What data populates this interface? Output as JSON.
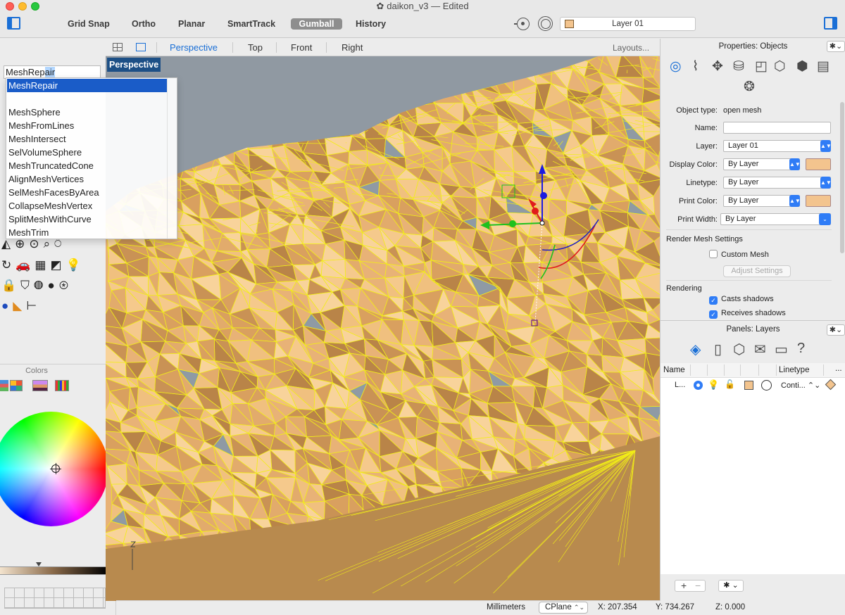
{
  "window": {
    "title": "daikon_v3 — Edited"
  },
  "toolbar": {
    "grid_snap": "Grid Snap",
    "ortho": "Ortho",
    "planar": "Planar",
    "smarttrack": "SmartTrack",
    "gumball": "Gumball",
    "history": "History",
    "current_layer": "Layer 01",
    "current_layer_color": "#f3c48e"
  },
  "viewport_tabs": {
    "tabs": [
      "Perspective",
      "Top",
      "Front",
      "Right"
    ],
    "active": "Perspective",
    "layouts": "Layouts..."
  },
  "command": {
    "input_typed": "MeshRep",
    "input_autocomplete": "air",
    "suggestions": [
      "MeshRepair",
      "MeshSphere",
      "MeshFromLines",
      "MeshIntersect",
      "SelVolumeSphere",
      "MeshTruncatedCone",
      "AlignMeshVertices",
      "SelMeshFacesByArea",
      "CollapseMeshVertex",
      "SplitMeshWithCurve",
      "MeshTrim"
    ],
    "selected": "MeshRepair"
  },
  "viewport": {
    "label": "Perspective",
    "axis_z": "Z"
  },
  "colors_panel": {
    "title": "Colors",
    "brightness": 0.34
  },
  "statusbar": {
    "units": "Millimeters",
    "cplane": "CPlane",
    "x": "X: 207.354",
    "y": "Y: 734.267",
    "z": "Z: 0.000"
  },
  "properties": {
    "title": "Properties: Objects",
    "object_type_label": "Object type:",
    "object_type": "open mesh",
    "name_label": "Name:",
    "name_value": "",
    "layer_label": "Layer:",
    "layer_value": "Layer 01",
    "display_color_label": "Display Color:",
    "display_color_value": "By Layer",
    "linetype_label": "Linetype:",
    "linetype_value": "By Layer",
    "print_color_label": "Print Color:",
    "print_color_value": "By Layer",
    "print_width_label": "Print Width:",
    "print_width_value": "By Layer",
    "render_mesh_heading": "Render Mesh Settings",
    "custom_mesh": "Custom Mesh",
    "custom_mesh_checked": false,
    "adjust_settings": "Adjust Settings",
    "rendering_heading": "Rendering",
    "casts_shadows": "Casts shadows",
    "casts_shadows_checked": true,
    "receives_shadows": "Receives shadows",
    "receives_shadows_checked": true,
    "layer_color": "#f3c48e"
  },
  "layers_panel": {
    "title": "Panels: Layers",
    "columns": {
      "name": "Name",
      "linetype": "Linetype",
      "more": "..."
    },
    "rows": [
      {
        "name": "L...",
        "linetype": "Conti...",
        "color": "#f3c48e"
      }
    ]
  },
  "colors": {
    "mesh_fill": "#e8b277",
    "wireframe": "#f2ee17",
    "background": "#9099a2",
    "viewport_label_bg": "#1c4f86",
    "accent": "#1a6fd6"
  }
}
